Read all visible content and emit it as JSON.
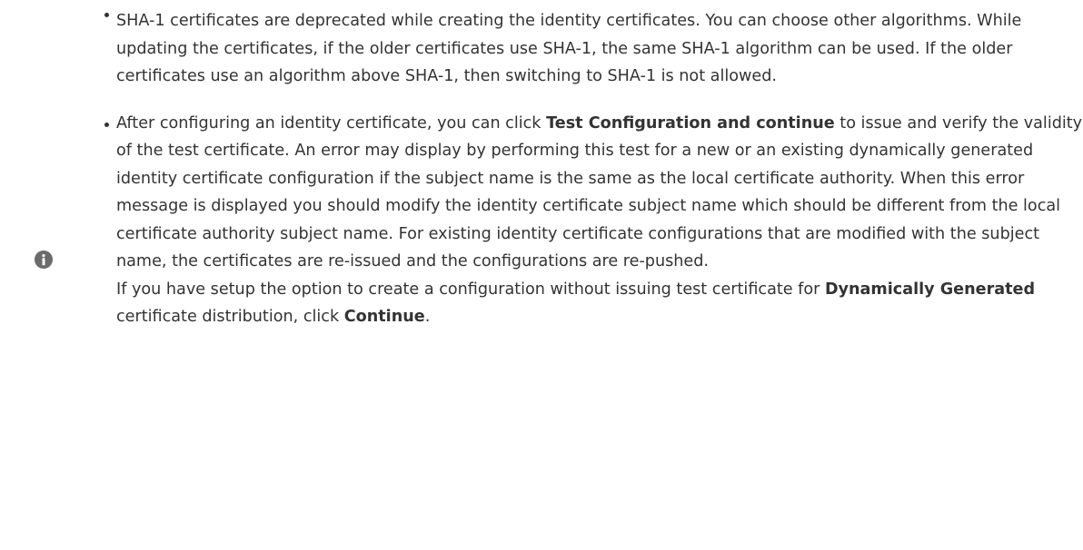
{
  "note": {
    "icon": "info-icon",
    "icon_color": "#6b6b6b",
    "text_color": "#333333",
    "items": [
      {
        "text": "SHA-1 certificates are deprecated while creating the identity certificates. You can choose other algorithms. While updating the certificates, if the older certificates use SHA-1, the same SHA-1 algorithm can be used. If the older certificates use an algorithm above SHA-1, then switching to SHA-1 is not allowed."
      },
      {
        "p1_before": "After configuring an identity certificate, you can click ",
        "p1_bold": "Test Configuration and continue",
        "p1_after": " to issue and verify the validity of the test certificate. An error may display by performing this test for a new or an existing dynamically generated identity certificate configuration if the subject name is the same as the local certificate authority. When this error message is displayed you should modify the identity certificate subject name which should be different from the local certificate authority subject name. For existing identity certificate configurations that are modified with the subject name, the certificates are re-issued and the configurations are re-pushed.",
        "p2_before": "If you have setup the option to create a configuration without issuing test certificate for ",
        "p2_bold1": "Dynamically Generated",
        "p2_middle": " certificate distribution, click ",
        "p2_bold2": "Continue",
        "p2_end": "."
      }
    ]
  }
}
